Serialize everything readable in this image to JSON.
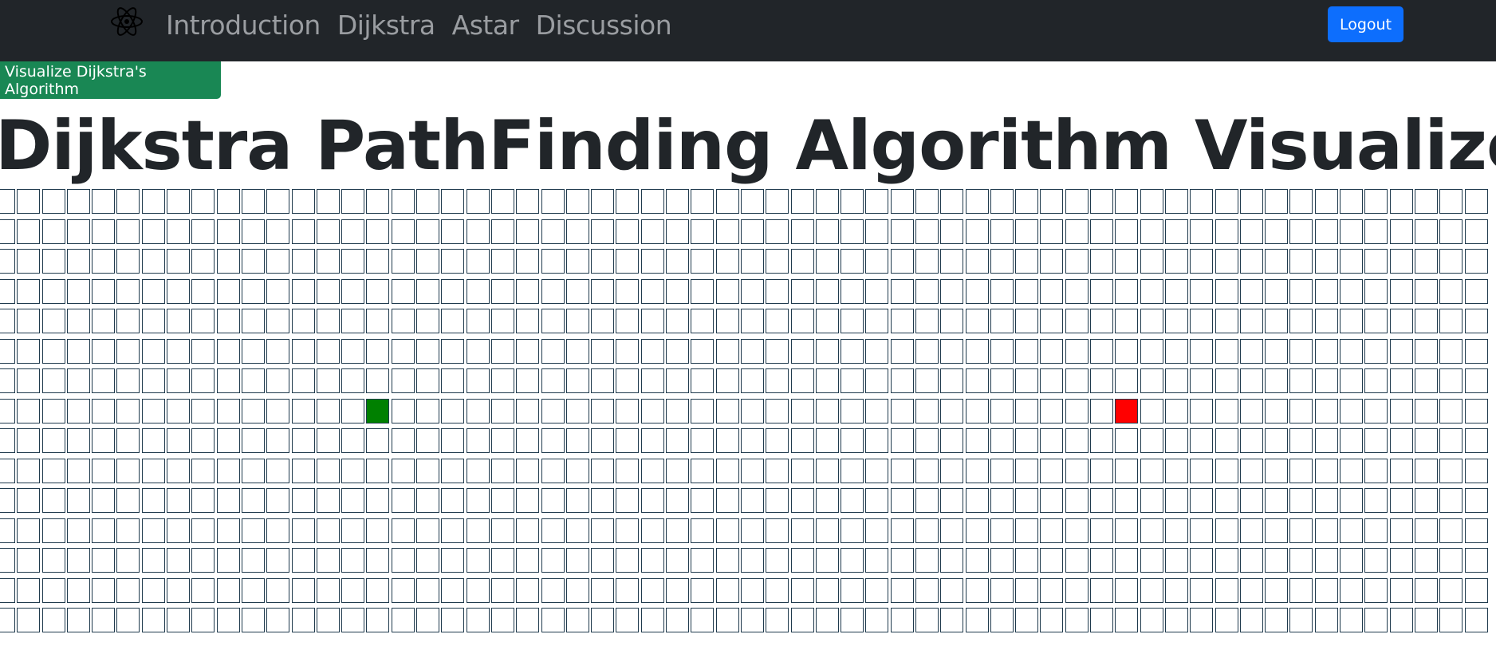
{
  "navbar": {
    "brand_icon": "atom-icon",
    "links": [
      "Introduction",
      "Dijkstra",
      "Astar",
      "Discussion"
    ],
    "logout_label": "Logout",
    "background": "#212529",
    "link_color": "#9a9da1"
  },
  "toolbar": {
    "visualize_label": "Visualize Dijkstra's Algorithm",
    "visualize_color": "#198754",
    "logout_color": "#0d6efd"
  },
  "page": {
    "title": "Dijkstra PathFinding Algorithm Visualizer"
  },
  "grid": {
    "rows": 15,
    "cols": 60,
    "start_node": {
      "row": 7,
      "col": 15,
      "color": "#008000"
    },
    "end_node": {
      "row": 7,
      "col": 45,
      "color": "#ff0000"
    }
  }
}
